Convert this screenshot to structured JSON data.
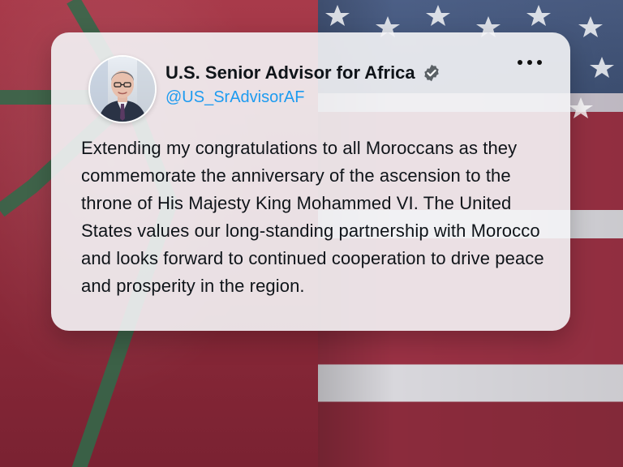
{
  "colors": {
    "accent": "#1d9bf0",
    "text": "#0f1419",
    "card_background": "#f4f4f6",
    "morocco_red": "#a83a4a",
    "morocco_green": "#2f6b4a",
    "us_blue": "#3f5276",
    "us_white": "#d7d6db",
    "us_red": "#9a3144",
    "verified_badge": "#5b6166"
  },
  "background": {
    "left_image": "morocco-flag",
    "right_image": "us-flag"
  },
  "tweet": {
    "author": {
      "display_name": "U.S. Senior Advisor for Africa",
      "handle": "@US_SrAdvisorAF",
      "verified_icon": "verified-badge-icon",
      "avatar": "profile-photo"
    },
    "more_icon": "more-options-icon",
    "text": "Extending my congratulations to all Moroccans as they commemorate the anniversary of the ascension to the throne of His Majesty King Mohammed VI. The United States values our long-standing partnership with Morocco and looks forward to continued cooperation to drive peace and prosperity in the region."
  }
}
